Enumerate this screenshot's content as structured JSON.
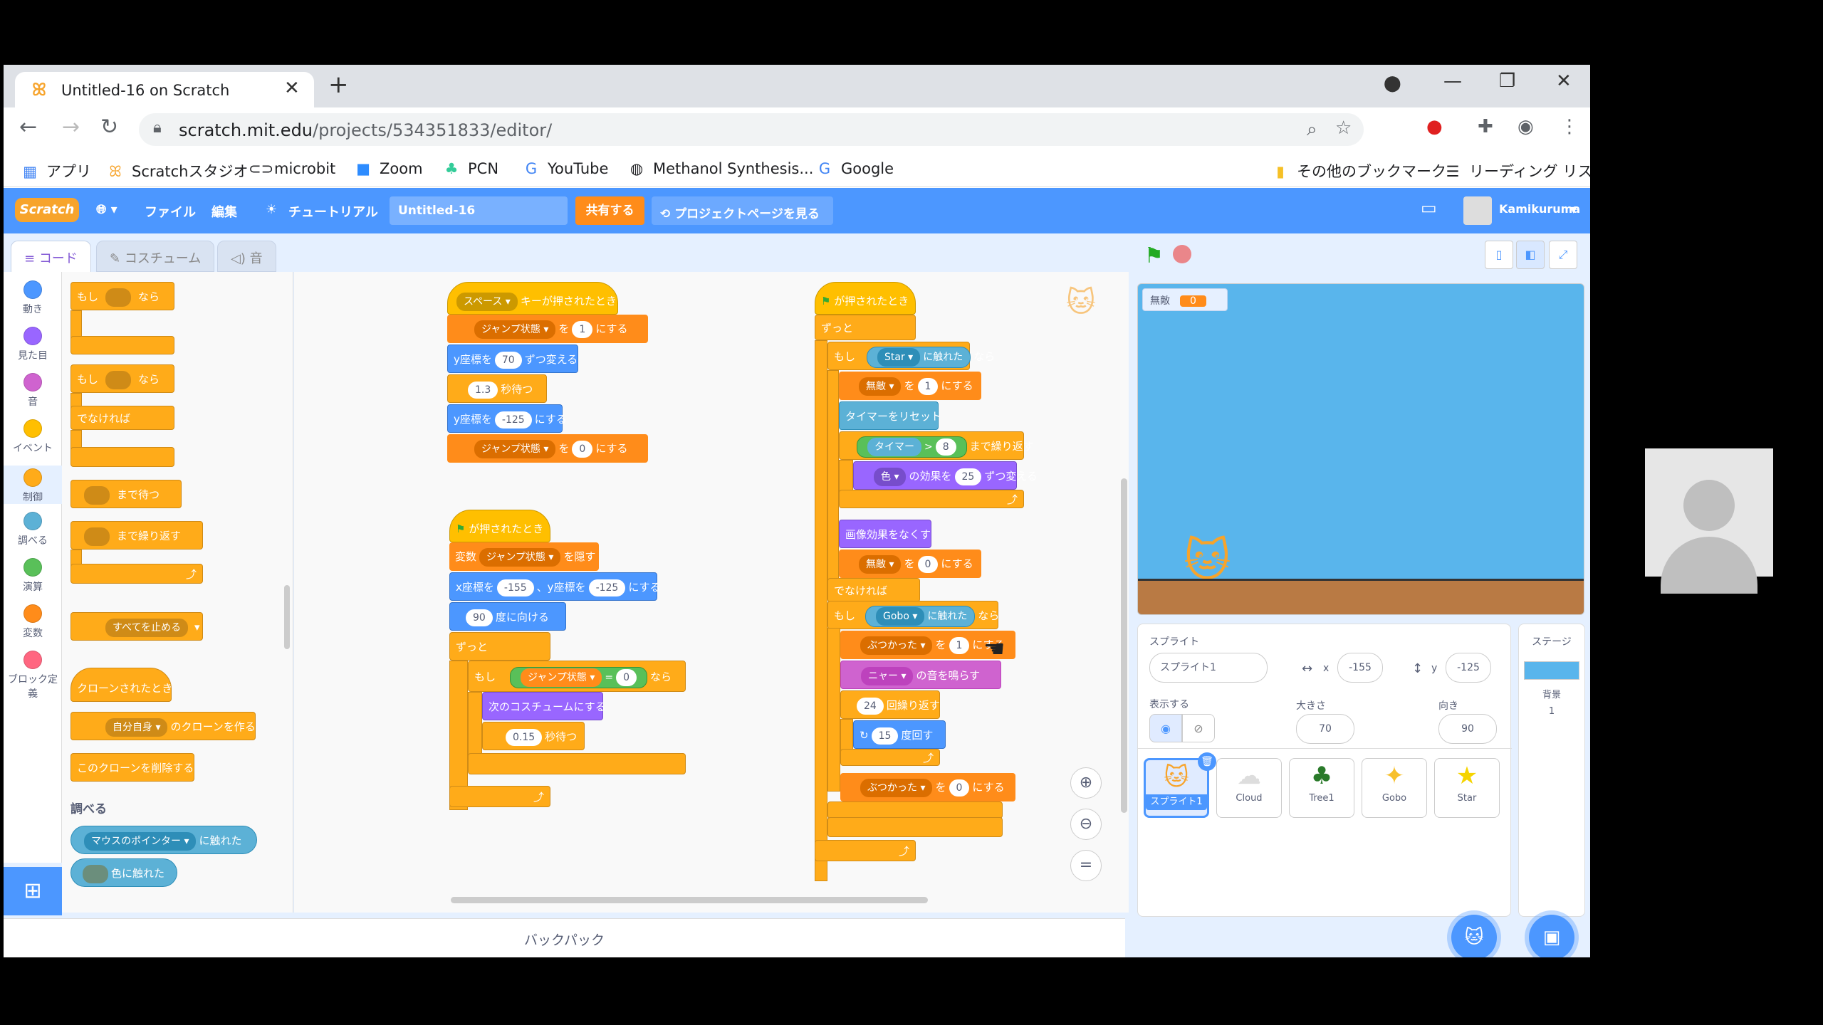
{
  "browser": {
    "tab_title": "Untitled-16 on Scratch",
    "tab_close": "✕",
    "new_tab": "+",
    "url_host": "scratch.mit.edu",
    "url_path": "/projects/534351833/editor/",
    "bookmarks": [
      "アプリ",
      "Scratchスタジオ",
      "microbit",
      "Zoom",
      "PCN",
      "YouTube",
      "Methanol Synthesis...",
      "Google"
    ],
    "bookmarks_right": [
      "その他のブックマーク",
      "リーディング リスト"
    ]
  },
  "scratch": {
    "logo": "Scratch",
    "menu": {
      "file": "ファイル",
      "edit": "編集",
      "tutorial": "チュートリアル",
      "share": "共有する",
      "project_page": "プロジェクトページを見る",
      "user": "Kamikuruma"
    },
    "project_title": "Untitled-16",
    "tabs": {
      "code": "コード",
      "costume": "コスチューム",
      "sound": "音"
    },
    "categories": [
      {
        "label": "動き",
        "color": "#4c97ff"
      },
      {
        "label": "見た目",
        "color": "#9966ff"
      },
      {
        "label": "音",
        "color": "#cf63cf"
      },
      {
        "label": "イベント",
        "color": "#ffbf00"
      },
      {
        "label": "制御",
        "color": "#ffab19"
      },
      {
        "label": "調べる",
        "color": "#5cb1d6"
      },
      {
        "label": "演算",
        "color": "#59c059"
      },
      {
        "label": "変数",
        "color": "#ff8c1a"
      },
      {
        "label": "ブロック定義",
        "color": "#ff6680"
      }
    ],
    "palette": {
      "if": "もし",
      "then": "なら",
      "else": "でなければ",
      "wait_until": "まで待つ",
      "repeat_until": "まで繰り返す",
      "stop": "すべてを止める",
      "when_clone": "クローンされたとき",
      "myself": "自分自身",
      "create_clone": "のクローンを作る",
      "delete_clone": "このクローンを削除する",
      "sensing_header": "調べる",
      "mouse_pointer": "マウスのポインター",
      "touching": "に触れた",
      "color_touching": "色に触れた"
    },
    "scripts": {
      "space": "スペース",
      "key_pressed": "キーが押されたとき",
      "jump_state": "ジャンプ状態",
      "wo": "を",
      "set_to": "にする",
      "one": "1",
      "zero": "0",
      "change_y": "y座標を",
      "seventy": "70",
      "change_by": "ずつ変える",
      "wait_val": "1.3",
      "sec_wait": "秒待つ",
      "set_y": "y座標を",
      "neg125": "-125",
      "flag": "が押されたとき",
      "variable": "変数",
      "hide": "を隠す",
      "x_to": "x座標を",
      "neg155": "-155",
      "y_to": "、y座標を",
      "ninety": "90",
      "point_dir": "度に向ける",
      "forever": "ずっと",
      "if": "もし",
      "then": "なら",
      "eq": "=",
      "next_costume": "次のコスチュームにする",
      "wait2": "0.15",
      "star": "Star",
      "touching": "に触れた",
      "invincible": "無敵",
      "reset_timer": "タイマーをリセット",
      "timer": "タイマー",
      "gt": ">",
      "eight": "8",
      "until_repeat": "まで繰り返す",
      "color": "色",
      "effect_change": "の効果を",
      "twentyfive": "25",
      "clear_effects": "画像効果をなくす",
      "else": "でなければ",
      "gobo": "Gobo",
      "collided": "ぶつかった",
      "meow": "ニャー",
      "play_sound": "の音を鳴らす",
      "twentyfour": "24",
      "repeat": "回繰り返す",
      "fifteen": "15",
      "turn": "度回す"
    },
    "stage": {
      "monitor_label": "無敵",
      "monitor_value": "0"
    },
    "sprite_info": {
      "sprite_label": "スプライト",
      "sprite_name": "スプライト1",
      "x_label": "x",
      "x_value": "-155",
      "y_label": "y",
      "y_value": "-125",
      "show_label": "表示する",
      "size_label": "大きさ",
      "size_value": "70",
      "dir_label": "向き",
      "dir_value": "90"
    },
    "sprites": [
      "スプライト1",
      "Cloud",
      "Tree1",
      "Gobo",
      "Star"
    ],
    "stage_panel": {
      "title": "ステージ",
      "backdrops_label": "背景",
      "backdrops_count": "1"
    },
    "backpack": "バックパック"
  }
}
